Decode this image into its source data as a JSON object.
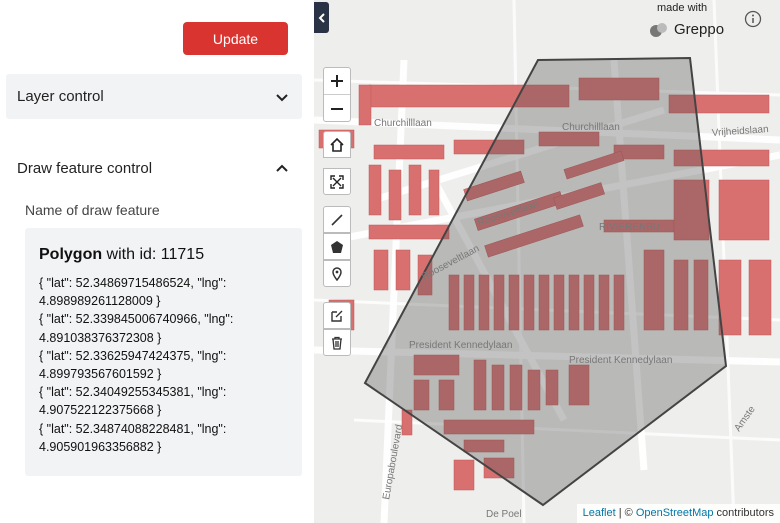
{
  "sidebar": {
    "update_label": "Update",
    "layer_control_label": "Layer control",
    "draw_control_label": "Draw feature control",
    "name_label": "Name of draw feature",
    "feature": {
      "title_type": "Polygon",
      "title_rest": " with id: 11715",
      "coords": [
        "{ \"lat\": 52.34869715486524, \"lng\": 4.898989261128009 }",
        "{ \"lat\": 52.339845006740966, \"lng\": 4.891038376372308 }",
        "{ \"lat\": 52.33625947424375, \"lng\": 4.899793567601592 }",
        "{ \"lat\": 52.34049255345381, \"lng\": 4.907522122375668 }",
        "{ \"lat\": 52.34874088228481, \"lng\": 4.905901963356882 }"
      ]
    }
  },
  "map": {
    "brand_made": "made with",
    "brand_name": "Greppo",
    "attribution": {
      "leaflet": "Leaflet",
      "sep": " | © ",
      "osm": "OpenStreetMap",
      "rest": " contributors"
    },
    "streets": {
      "president_kennedylaan": "President Kennedylaan",
      "roosevelt_1": "Rooseveltlaan",
      "roosevelt_2": "Rooseveltlaan",
      "churchilllaan_1": "Churchilllaan",
      "churchilllaan_2": "Churchilllaan",
      "vrijheidslaan": "Vrijheidslaan",
      "europaboulevard": "Europaboulevard",
      "de_poel": "De Poel",
      "amstel": "Amste",
      "rivierenbuurt": "RIVIERENBU"
    },
    "icons": [
      "zoom-in-icon",
      "zoom-out-icon",
      "home-icon",
      "fullscreen-icon",
      "polyline-icon",
      "polygon-icon",
      "marker-icon",
      "edit-icon",
      "trash-icon"
    ]
  },
  "colors": {
    "update_button": "#d9342f",
    "buildings": "#d97070",
    "polygon_fill": "#555555",
    "collapse_tab": "#2a3346"
  }
}
